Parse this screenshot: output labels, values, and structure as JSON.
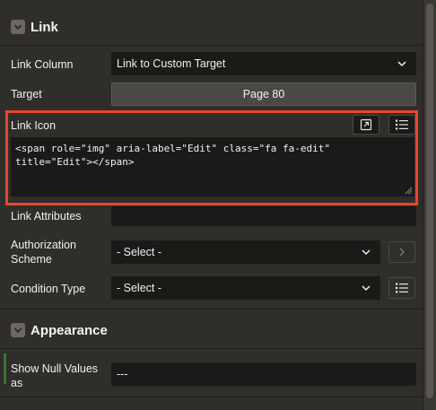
{
  "sections": {
    "link": {
      "title": "Link"
    },
    "appearance": {
      "title": "Appearance"
    }
  },
  "fields": {
    "link_column": {
      "label": "Link Column",
      "value": "Link to Custom Target"
    },
    "target": {
      "label": "Target",
      "value": "Page 80"
    },
    "link_icon": {
      "label": "Link Icon",
      "value": "<span role=\"img\" aria-label=\"Edit\" class=\"fa fa-edit\"\ntitle=\"Edit\"></span>"
    },
    "link_attributes": {
      "label": "Link Attributes",
      "value": ""
    },
    "authorization_scheme": {
      "label_line1": "Authorization",
      "label_line2": "Scheme",
      "value": "- Select -"
    },
    "condition_type": {
      "label": "Condition Type",
      "value": "- Select -"
    },
    "show_null_values": {
      "label_line1": "Show Null Values",
      "label_line2": "as",
      "value": "---"
    }
  },
  "icons": {
    "expand": "expand-icon",
    "list": "list-icon",
    "chevron": "chevron-down-icon",
    "arrow": "chevron-right-icon"
  },
  "colors": {
    "highlight": "#e8462a",
    "panel": "#302e2b",
    "field": "#1b1a18"
  }
}
